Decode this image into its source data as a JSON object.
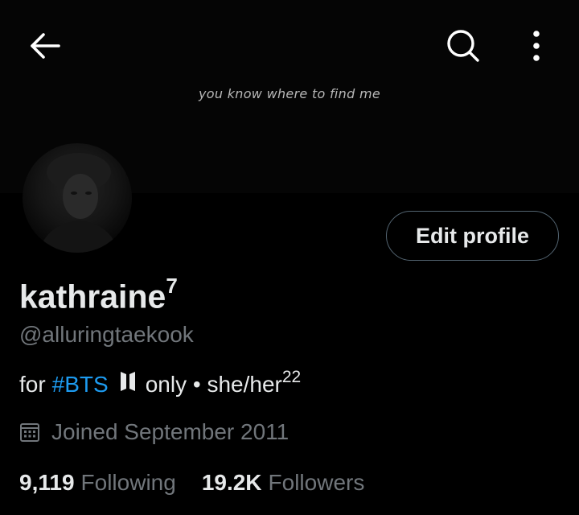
{
  "header": {
    "banner_caption": "you know where to find me",
    "back_icon": "arrow-left-icon",
    "search_icon": "search-icon",
    "more_icon": "more-vertical-icon"
  },
  "profile": {
    "display_name": "kathraine",
    "display_name_sup": "7",
    "handle": "@alluringtaekook",
    "edit_profile_label": "Edit profile",
    "bio": {
      "prefix": "for",
      "hashtag": "#BTS",
      "logo": "bts-logo-icon",
      "rest": "only • she/her",
      "rest_sup": "22"
    },
    "joined": "Joined September 2011",
    "following_count": "9,119",
    "following_label": "Following",
    "followers_count": "19.2K",
    "followers_label": "Followers"
  },
  "colors": {
    "background": "#000000",
    "primary_text": "#e7e9ea",
    "secondary_text": "#71767b",
    "accent": "#1d9bf0",
    "border": "#536471"
  }
}
